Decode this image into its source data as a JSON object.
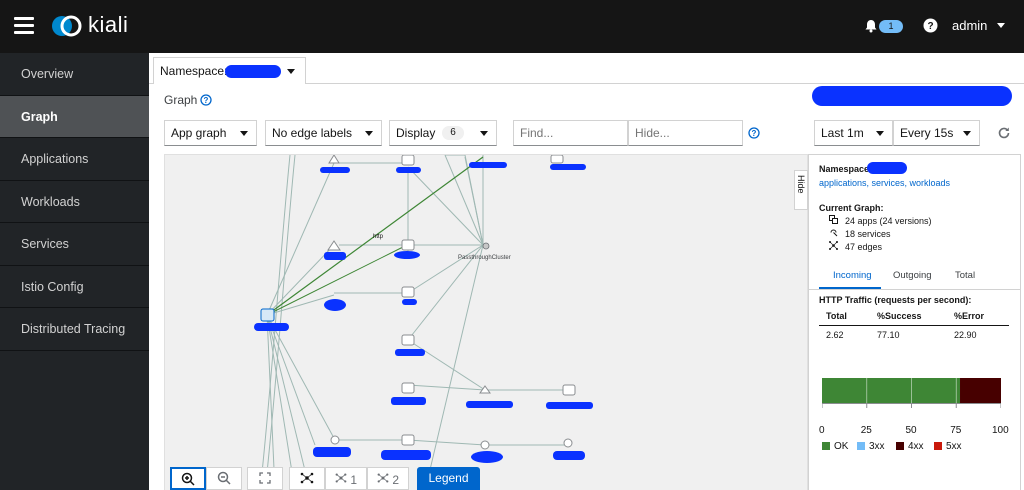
{
  "app": {
    "brand": "kiali",
    "user": "admin",
    "notifications": "1"
  },
  "sidebar": {
    "items": [
      {
        "label": "Overview"
      },
      {
        "label": "Graph"
      },
      {
        "label": "Applications"
      },
      {
        "label": "Workloads"
      },
      {
        "label": "Services"
      },
      {
        "label": "Istio Config"
      },
      {
        "label": "Distributed Tracing"
      }
    ],
    "active": "Graph"
  },
  "namespace_bar": {
    "label": "Namespace:"
  },
  "page": {
    "title": "Graph"
  },
  "toolbar": {
    "graph_type": "App graph",
    "edge_labels": "No edge labels",
    "display": "Display",
    "display_count": "6",
    "find_placeholder": "Find...",
    "hide_placeholder": "Hide...",
    "duration": "Last 1m",
    "refresh": "Every 15s"
  },
  "graph": {
    "edge_label": "http",
    "passthrough_label": "PassthroughCluster",
    "hide_tab": "Hide"
  },
  "graph_controls": {
    "layout1": "1",
    "layout2": "2",
    "legend": "Legend"
  },
  "side_panel": {
    "namespace_label": "Namespace:",
    "links": "applications, services, workloads",
    "current_graph_label": "Current Graph:",
    "apps": "24 apps (24 versions)",
    "services": "18 services",
    "edges": "47 edges",
    "tabs": [
      "Incoming",
      "Outgoing",
      "Total"
    ],
    "active_tab": "Incoming",
    "traffic_title": "HTTP Traffic (requests per second):",
    "table_headers": [
      "Total",
      "%Success",
      "%Error"
    ],
    "table_row": [
      "2.62",
      "77.10",
      "22.90"
    ]
  },
  "chart_data": {
    "type": "bar",
    "orientation": "horizontal-stacked",
    "series": [
      {
        "name": "OK",
        "values": [
          77.1
        ],
        "color": "#3e8635"
      },
      {
        "name": "3xx",
        "values": [
          0
        ],
        "color": "#73bcf7"
      },
      {
        "name": "4xx",
        "values": [
          22.9
        ],
        "color": "#470000"
      },
      {
        "name": "5xx",
        "values": [
          0
        ],
        "color": "#c9190b"
      }
    ],
    "xlim": [
      0,
      100
    ],
    "x_ticks": [
      "0",
      "25",
      "50",
      "75",
      "100"
    ],
    "legend_placement": "bottom"
  },
  "colors": {
    "accent": "#06c",
    "masthead": "#151515",
    "sidebar": "#212427"
  }
}
